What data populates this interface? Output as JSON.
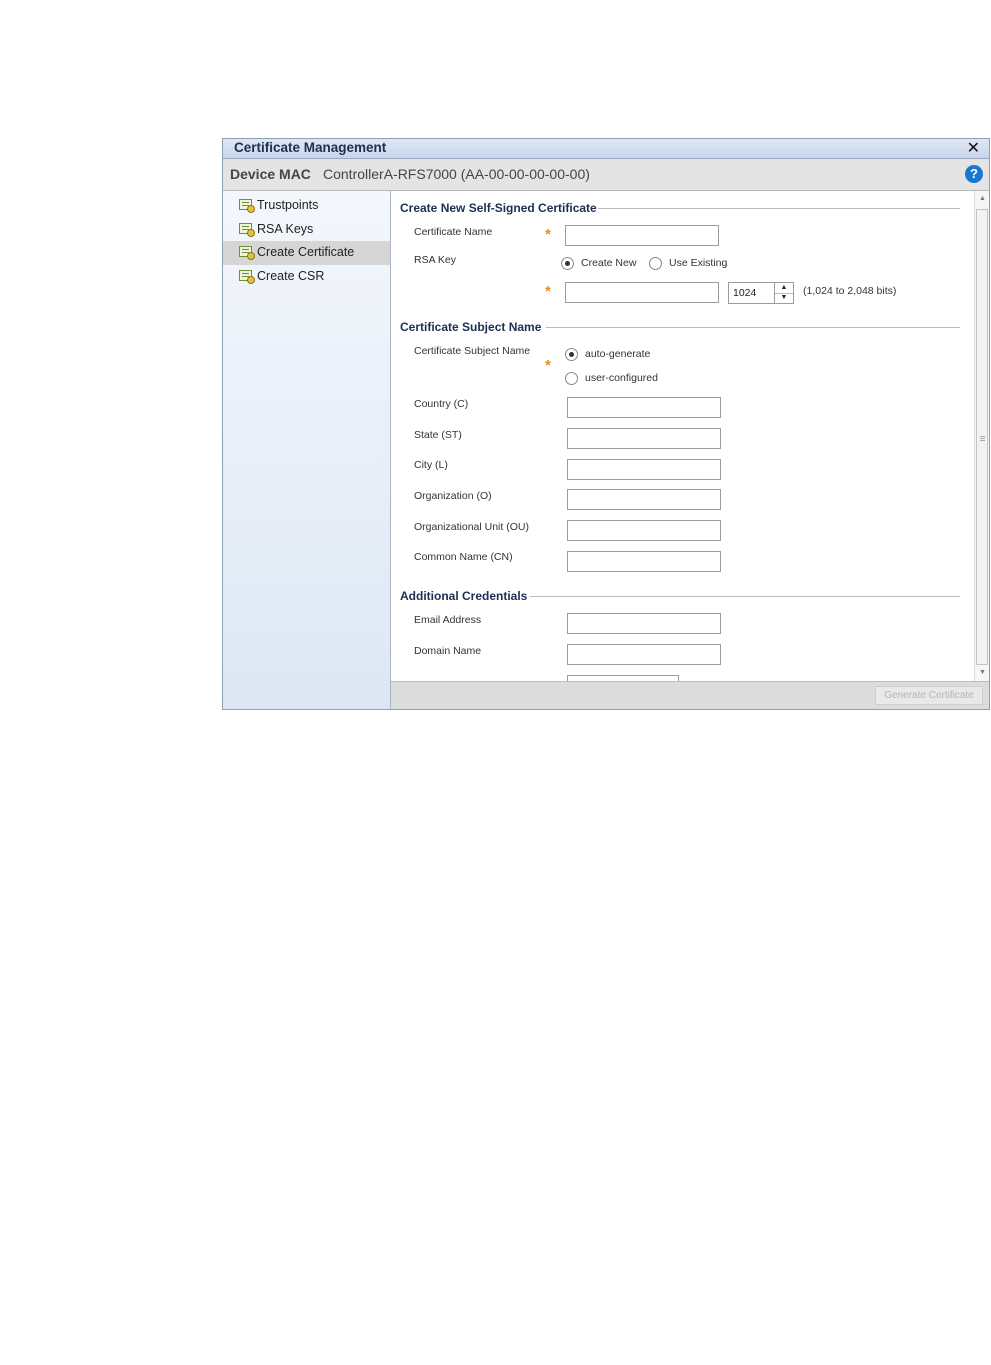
{
  "window": {
    "title": "Certificate Management",
    "close_icon": "close-icon"
  },
  "device_bar": {
    "label": "Device MAC",
    "value": "ControllerA-RFS7000 (AA-00-00-00-00-00)",
    "help_glyph": "?"
  },
  "sidebar": {
    "items": [
      {
        "label": "Trustpoints",
        "icon": "certificate-icon",
        "selected": false
      },
      {
        "label": "RSA Keys",
        "icon": "certificate-icon",
        "selected": false
      },
      {
        "label": "Create Certificate",
        "icon": "certificate-icon",
        "selected": true
      },
      {
        "label": "Create CSR",
        "icon": "certificate-icon",
        "selected": false
      }
    ]
  },
  "form": {
    "sections": {
      "self_signed": "Create New Self-Signed Certificate",
      "subject_name": "Certificate Subject Name",
      "additional": "Additional Credentials"
    },
    "certificate_name": {
      "label": "Certificate Name",
      "value": ""
    },
    "rsa_key": {
      "label": "RSA Key",
      "options": [
        "Create New",
        "Use Existing"
      ],
      "selected": "Create New",
      "key_name_value": "",
      "key_size": "1024",
      "key_size_hint": "(1,024 to 2,048 bits)"
    },
    "subject_name": {
      "label": "Certificate Subject Name",
      "options": [
        "auto-generate",
        "user-configured"
      ],
      "selected": "auto-generate"
    },
    "fields": [
      {
        "label": "Country (C)",
        "value": ""
      },
      {
        "label": "State (ST)",
        "value": ""
      },
      {
        "label": "City (L)",
        "value": ""
      },
      {
        "label": "Organization (O)",
        "value": ""
      },
      {
        "label": "Organizational Unit (OU)",
        "value": ""
      },
      {
        "label": "Common Name (CN)",
        "value": ""
      }
    ],
    "credentials": [
      {
        "label": "Email Address",
        "value": ""
      },
      {
        "label": "Domain Name",
        "value": ""
      }
    ],
    "required_marker": "*"
  },
  "footer": {
    "generate_button": "Generate Certificate"
  },
  "colors": {
    "title_text": "#1d2f52",
    "required": "#f08a17",
    "help": "#1877d2",
    "selected_nav": "#d6d6d6"
  }
}
